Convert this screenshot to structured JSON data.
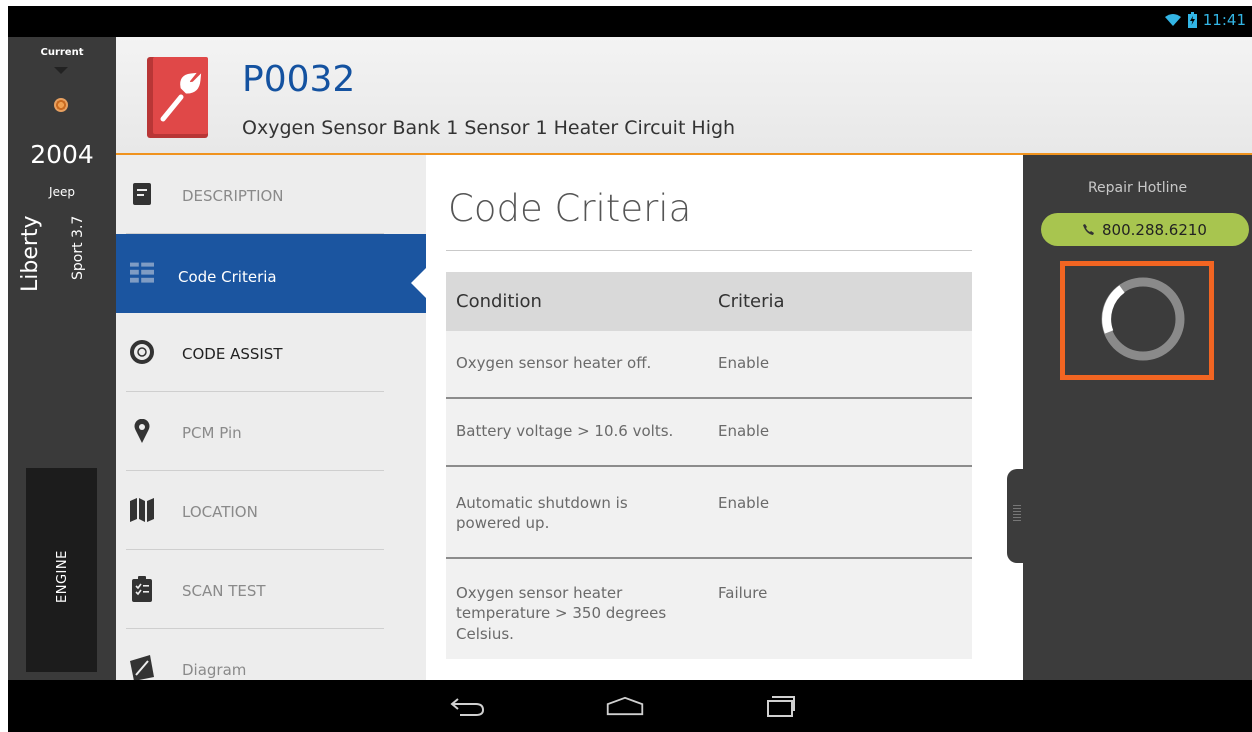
{
  "status": {
    "time": "11:41"
  },
  "vehicle": {
    "current_label": "Current",
    "year": "2004",
    "make": "Jeep",
    "model": "Liberty",
    "trim": "Sport 3.7",
    "system": "ENGINE"
  },
  "header": {
    "code": "P0032",
    "description": "Oxygen Sensor Bank 1 Sensor 1 Heater Circuit High",
    "icon": "wrench-book-icon"
  },
  "menu": {
    "items": [
      {
        "label": "DESCRIPTION",
        "icon": "document-icon",
        "state": "normal"
      },
      {
        "label": "Code Criteria",
        "icon": "grid-icon",
        "state": "active"
      },
      {
        "label": "CODE ASSIST",
        "icon": "lifebuoy-icon",
        "state": "dark"
      },
      {
        "label": "PCM Pin",
        "icon": "location-pin-icon",
        "state": "normal"
      },
      {
        "label": "LOCATION",
        "icon": "map-icon",
        "state": "normal"
      },
      {
        "label": "SCAN TEST",
        "icon": "clipboard-icon",
        "state": "normal"
      },
      {
        "label": "Diagram",
        "icon": "diagram-icon",
        "state": "normal"
      }
    ]
  },
  "content": {
    "title": "Code Criteria",
    "table": {
      "headers": [
        "Condition",
        "Criteria"
      ],
      "rows": [
        [
          "Oxygen sensor heater off.",
          "Enable"
        ],
        [
          "Battery voltage > 10.6 volts.",
          "Enable"
        ],
        [
          "Automatic shutdown is powered up.",
          "Enable"
        ],
        [
          "Oxygen sensor heater temperature > 350 degrees Celsius.",
          "Failure"
        ]
      ]
    }
  },
  "right_panel": {
    "hotline_label": "Repair Hotline",
    "hotline_number": "800.288.6210"
  },
  "colors": {
    "accent_blue": "#1b55a0",
    "header_rule": "#f0931e",
    "hotline_green": "#a8c54f",
    "focus_orange": "#f26522",
    "code_icon_red": "#e04848"
  }
}
